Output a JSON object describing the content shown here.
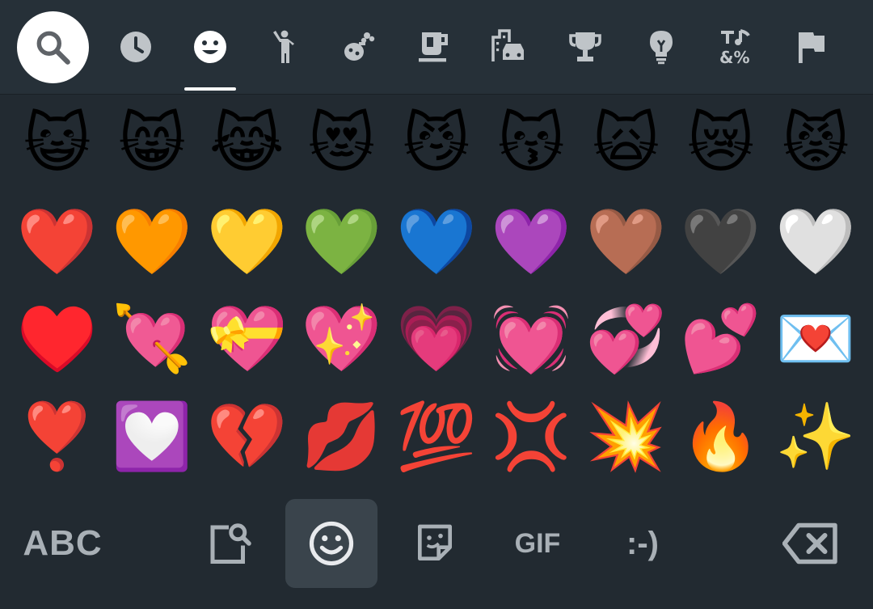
{
  "top_bar": {
    "categories": [
      {
        "icon": "search-icon"
      },
      {
        "icon": "recent-clock-icon"
      },
      {
        "icon": "smileys-icon",
        "selected": true
      },
      {
        "icon": "people-icon"
      },
      {
        "icon": "animals-nature-icon"
      },
      {
        "icon": "food-drink-icon"
      },
      {
        "icon": "travel-places-icon"
      },
      {
        "icon": "activities-trophy-icon"
      },
      {
        "icon": "objects-lightbulb-icon"
      },
      {
        "icon": "symbols-icon"
      },
      {
        "icon": "flags-icon"
      }
    ]
  },
  "emoji_grid": {
    "rows": [
      [
        "😺",
        "😸",
        "😹",
        "😻",
        "😼",
        "😽",
        "🙀",
        "😿",
        "😾"
      ],
      [
        "❤️",
        "🧡",
        "💛",
        "💚",
        "💙",
        "💜",
        "🤎",
        "🖤",
        "🤍"
      ],
      [
        "♥️",
        "💘",
        "💝",
        "💖",
        "💗",
        "💓",
        "💞",
        "💕",
        "💌"
      ],
      [
        "❣️",
        "💟",
        "💔",
        "💋",
        "💯",
        "💢",
        "💥",
        "🔥",
        "✨"
      ]
    ]
  },
  "bottom_bar": {
    "abc_label": "ABC",
    "gif_label": "GIF",
    "emoticon_label": ":-)",
    "selected_tab": "emoji",
    "colors": {
      "icon": "#a9b0b6",
      "active_bg": "#3a444c",
      "background": "#222a31"
    }
  }
}
